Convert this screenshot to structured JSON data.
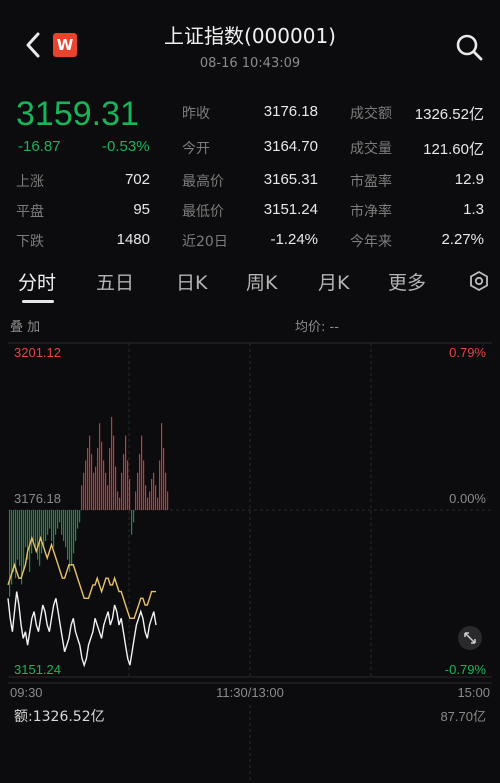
{
  "header": {
    "title": "上证指数(000001)",
    "subtitle": "08-16 10:43:09",
    "logo_text": "W",
    "back_icon": "chevron-left-icon",
    "search_icon": "search-icon"
  },
  "quote": {
    "price": "3159.31",
    "change": "-16.87",
    "change_pct": "-0.53%",
    "prev_close_label": "昨收",
    "prev_close": "3176.18",
    "open_label": "今开",
    "open": "3164.70",
    "turnover_label": "成交额",
    "turnover": "1326.52亿",
    "volume_label": "成交量",
    "volume": "121.60亿",
    "up_label": "上涨",
    "up": "702",
    "flat_label": "平盘",
    "flat": "95",
    "down_label": "下跌",
    "down": "1480",
    "high_label": "最高价",
    "high": "3165.31",
    "low_label": "最低价",
    "low": "3151.24",
    "d20_label": "近20日",
    "d20": "-1.24%",
    "pe_label": "市盈率",
    "pe": "12.9",
    "pb_label": "市净率",
    "pb": "1.3",
    "ytd_label": "今年来",
    "ytd": "2.27%"
  },
  "tabs": [
    "分时",
    "五日",
    "日K",
    "周K",
    "月K",
    "更多"
  ],
  "chart_head": {
    "overlay": "叠 加",
    "avg": "均价: --"
  },
  "chart_data": {
    "type": "line",
    "y_top": "3201.12",
    "y_mid": "3176.18",
    "y_bottom": "3151.24",
    "pct_top": "0.79%",
    "pct_mid": "0.00%",
    "pct_bottom": "-0.79%",
    "x_start": "09:30",
    "x_mid": "11:30/13:00",
    "x_end": "15:00",
    "ylim": [
      3151.24,
      3201.12
    ],
    "prev_close": 3176.18,
    "price_series": [
      3163,
      3160,
      3158,
      3161,
      3164,
      3162,
      3159,
      3157,
      3158,
      3156,
      3158,
      3160,
      3161,
      3159,
      3158,
      3160,
      3162,
      3161,
      3159,
      3158,
      3160,
      3162,
      3163,
      3161,
      3159,
      3157,
      3155,
      3156,
      3157,
      3159,
      3160,
      3158,
      3157,
      3156,
      3154,
      3153,
      3154,
      3156,
      3157,
      3158,
      3160,
      3159,
      3158,
      3157,
      3159,
      3160,
      3161,
      3159,
      3160,
      3162,
      3161,
      3159,
      3160,
      3158,
      3156,
      3154,
      3153,
      3155,
      3157,
      3159,
      3160,
      3161,
      3160,
      3158,
      3157,
      3159,
      3160,
      3161,
      3159
    ],
    "avg_series": [
      3165,
      3166,
      3167,
      3168,
      3167,
      3166,
      3166,
      3167,
      3168,
      3170,
      3171,
      3172,
      3171,
      3170,
      3171,
      3172,
      3171,
      3170,
      3169,
      3170,
      3171,
      3170,
      3169,
      3168,
      3167,
      3166,
      3166,
      3167,
      3168,
      3168,
      3168,
      3167,
      3166,
      3165,
      3164,
      3163,
      3163,
      3163,
      3164,
      3165,
      3165,
      3166,
      3165,
      3164,
      3165,
      3166,
      3166,
      3165,
      3165,
      3166,
      3165,
      3164,
      3164,
      3163,
      3162,
      3161,
      3160,
      3160,
      3160,
      3161,
      3162,
      3163,
      3163,
      3162,
      3162,
      3163,
      3164,
      3164,
      3164
    ],
    "bars": [
      -14,
      -12,
      -10,
      -11,
      -8,
      -9,
      -12,
      -10,
      -6,
      -8,
      -10,
      -7,
      -5,
      -6,
      -8,
      -9,
      -7,
      -6,
      -5,
      -4,
      -3,
      -5,
      -6,
      -4,
      -3,
      -2,
      -4,
      -5,
      -6,
      -8,
      -10,
      -9,
      -7,
      -5,
      -3,
      -2,
      4,
      6,
      8,
      10,
      12,
      9,
      6,
      7,
      10,
      14,
      11,
      8,
      6,
      4,
      10,
      15,
      12,
      7,
      3,
      2,
      6,
      9,
      12,
      8,
      5,
      -4,
      -2,
      3,
      6,
      9,
      12,
      8,
      4,
      2,
      3,
      5,
      6,
      4,
      2,
      8,
      14,
      10,
      6,
      3
    ],
    "amount_label": "额:1326.52亿",
    "amount_max": "87.70亿"
  }
}
